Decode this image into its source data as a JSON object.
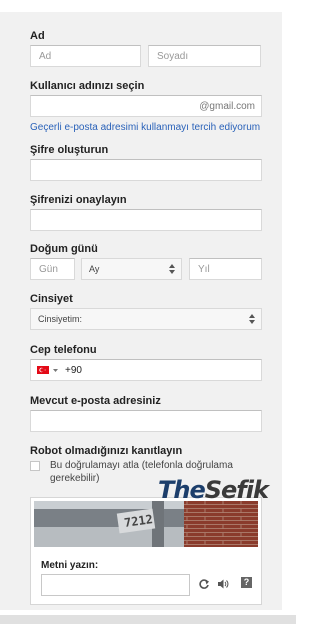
{
  "form": {
    "name": {
      "label": "Ad",
      "first_placeholder": "Ad",
      "last_placeholder": "Soyadı"
    },
    "username": {
      "label": "Kullanıcı adınızı seçin",
      "suffix": "@gmail.com",
      "link": "Geçerli e-posta adresimi kullanmayı tercih ediyorum"
    },
    "password": {
      "label": "Şifre oluşturun"
    },
    "confirm": {
      "label": "Şifrenizi onaylayın"
    },
    "birthday": {
      "label": "Doğum günü",
      "day_placeholder": "Gün",
      "month_value": "Ay",
      "year_placeholder": "Yıl"
    },
    "gender": {
      "label": "Cinsiyet",
      "value": "Cinsiyetim:"
    },
    "phone": {
      "label": "Cep telefonu",
      "country_code": "+90"
    },
    "current_email": {
      "label": "Mevcut e-posta adresiniz"
    },
    "robot": {
      "label": "Robot olmadığınızı kanıtlayın",
      "skip_text": "Bu doğrulamayı atla (telefonla doğrulama gerekebilir)"
    },
    "captcha": {
      "number": "7212",
      "input_label": "Metni yazın:"
    }
  },
  "watermark": {
    "part1": "The",
    "part2": "Sefik"
  },
  "icons": {
    "flag": "turkey-flag-icon",
    "refresh": "refresh-icon",
    "audio": "speaker-icon",
    "help": "help-icon"
  },
  "colors": {
    "link": "#2a62b9",
    "panel": "#f1f1f1",
    "flag_red": "#e30a17"
  }
}
